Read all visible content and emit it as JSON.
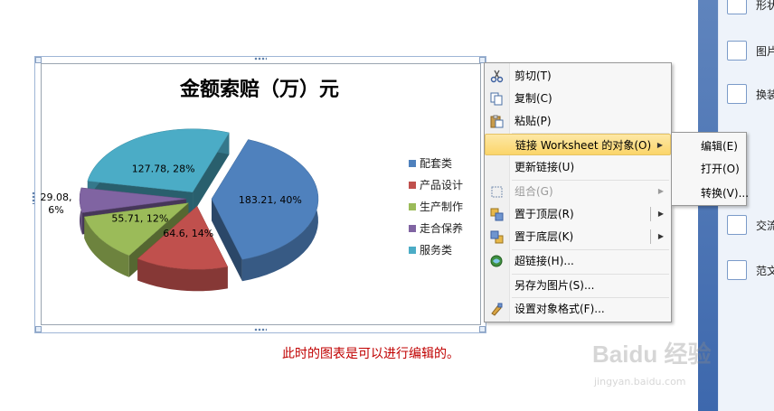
{
  "right_panel": {
    "items": [
      {
        "label": "形状",
        "icon": "shapes-icon"
      },
      {
        "label": "图片",
        "icon": "picture-icon"
      },
      {
        "label": "换装",
        "icon": "layout-icon"
      },
      {
        "label": "交流",
        "icon": "comment-icon"
      },
      {
        "label": "范文",
        "icon": "document-icon"
      }
    ]
  },
  "chart_data": {
    "type": "pie",
    "title": "金额索赔（万）元",
    "categories": [
      "配套类",
      "产品设计",
      "生产制作",
      "走合保养",
      "服务类"
    ],
    "values": [
      183.21,
      64.6,
      55.71,
      29.08,
      127.78
    ],
    "percents": [
      "40%",
      "14%",
      "12%",
      "6%",
      "28%"
    ],
    "data_labels": [
      "183.21, 40%",
      "64.6, 14%",
      "55.71, 12%",
      "29.08,\n6%",
      "127.78, 28%"
    ],
    "colors": [
      "#4f81bd",
      "#c0504d",
      "#9bbb59",
      "#8064a2",
      "#4bacc6"
    ],
    "exploded": true,
    "style": "3d",
    "legend_position": "right"
  },
  "caption": "此时的图表是可以进行编辑的。",
  "context_menu": {
    "items": [
      {
        "label": "剪切(T)",
        "icon": "scissors-icon",
        "enabled": true
      },
      {
        "label": "复制(C)",
        "icon": "copy-icon",
        "enabled": true
      },
      {
        "label": "粘贴(P)",
        "icon": "paste-icon",
        "enabled": true
      },
      {
        "label": "链接 Worksheet 的对象(O)",
        "icon": "",
        "enabled": true,
        "submenu": true,
        "highlighted": true
      },
      {
        "label": "更新链接(U)",
        "icon": "",
        "enabled": true
      },
      {
        "label": "组合(G)",
        "icon": "group-icon",
        "enabled": false,
        "submenu": true
      },
      {
        "label": "置于顶层(R)",
        "icon": "bring-front-icon",
        "enabled": true,
        "submenu": true
      },
      {
        "label": "置于底层(K)",
        "icon": "send-back-icon",
        "enabled": true,
        "submenu": true
      },
      {
        "label": "超链接(H)...",
        "icon": "hyperlink-icon",
        "enabled": true
      },
      {
        "label": "另存为图片(S)...",
        "icon": "",
        "enabled": true
      },
      {
        "label": "设置对象格式(F)...",
        "icon": "format-icon",
        "enabled": true
      }
    ]
  },
  "submenu": {
    "items": [
      "编辑(E)",
      "打开(O)",
      "转换(V)..."
    ]
  },
  "watermark": {
    "brand": "Baidu 经验",
    "url": "jingyan.baidu.com"
  }
}
